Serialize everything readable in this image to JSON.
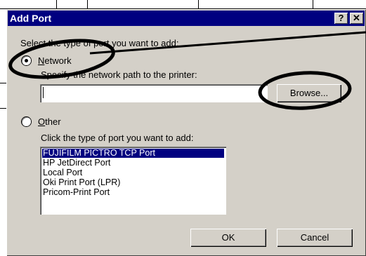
{
  "dialog": {
    "title": "Add Port",
    "help_label": "?",
    "close_label": "✕",
    "prompt": "Select the type of port you want to add:",
    "network": {
      "label": "Network",
      "selected": true,
      "description": "Specify the network path to the printer:",
      "path_value": "",
      "browse_label": "Browse..."
    },
    "other": {
      "label": "Other",
      "selected": false,
      "description": "Click the type of port you want to add:",
      "ports": [
        "FUJIFILM PICTRO TCP Port",
        "HP JetDirect Port",
        "Local Port",
        "Oki Print Port (LPR)",
        "Pricom-Print Port"
      ],
      "selected_port": "FUJIFILM PICTRO TCP Port"
    },
    "ok_label": "OK",
    "cancel_label": "Cancel"
  },
  "colors": {
    "titlebar": "#000080",
    "face": "#d4d0c8",
    "selection": "#000080"
  },
  "annotations": [
    "ellipse-around-network-option",
    "ellipse-around-browse-button",
    "pointer-line-top-right"
  ]
}
